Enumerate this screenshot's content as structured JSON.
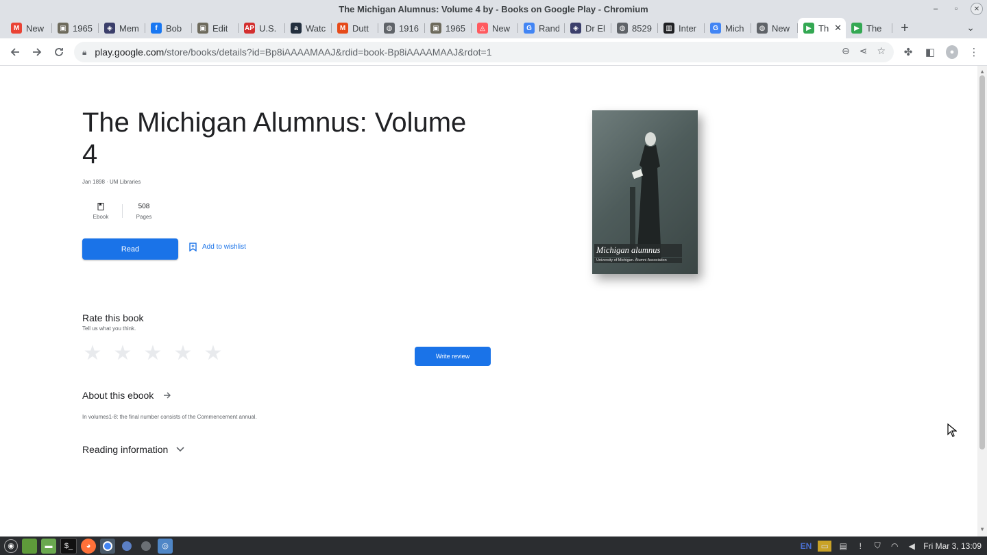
{
  "window": {
    "title": "The Michigan Alumnus: Volume 4 by - Books on Google Play - Chromium"
  },
  "tabs": [
    {
      "label": "New",
      "icon": "gmail-icon",
      "color": "#ea4335",
      "glyph": "M"
    },
    {
      "label": "1965",
      "icon": "photo-icon",
      "color": "#6d6a5c",
      "glyph": "▣"
    },
    {
      "label": "Mem",
      "icon": "memorial-icon",
      "color": "#3b3f6b",
      "glyph": "◈"
    },
    {
      "label": "Bob",
      "icon": "facebook-icon",
      "color": "#1877f2",
      "glyph": "f"
    },
    {
      "label": "Edit",
      "icon": "photo-icon",
      "color": "#6d6a5c",
      "glyph": "▣"
    },
    {
      "label": "U.S.",
      "icon": "ap-icon",
      "color": "#d32f2f",
      "glyph": "AP"
    },
    {
      "label": "Watc",
      "icon": "amazon-icon",
      "color": "#232f3e",
      "glyph": "a"
    },
    {
      "label": "Dutt",
      "icon": "newspaper-icon",
      "color": "#e64a19",
      "glyph": "M"
    },
    {
      "label": "1916",
      "icon": "globe-icon",
      "color": "#5f6368",
      "glyph": "◍"
    },
    {
      "label": "1965",
      "icon": "photo-icon",
      "color": "#6d6a5c",
      "glyph": "▣"
    },
    {
      "label": "New",
      "icon": "airbnb-icon",
      "color": "#ff5a5f",
      "glyph": "◬"
    },
    {
      "label": "Rand",
      "icon": "google-icon",
      "color": "#4285f4",
      "glyph": "G"
    },
    {
      "label": "Dr El",
      "icon": "memorial-icon",
      "color": "#3b3f6b",
      "glyph": "◈"
    },
    {
      "label": "8529",
      "icon": "globe-icon",
      "color": "#5f6368",
      "glyph": "◍"
    },
    {
      "label": "Inter",
      "icon": "archive-icon",
      "color": "#202124",
      "glyph": "▥"
    },
    {
      "label": "Mich",
      "icon": "google-icon",
      "color": "#4285f4",
      "glyph": "G"
    },
    {
      "label": "New",
      "icon": "globe-icon",
      "color": "#5f6368",
      "glyph": "◍"
    },
    {
      "label": "Th",
      "icon": "google-play-icon",
      "color": "#34a853",
      "glyph": "▶",
      "active": true
    },
    {
      "label": "The",
      "icon": "google-play-icon",
      "color": "#34a853",
      "glyph": "▶"
    }
  ],
  "omnibox": {
    "host": "play.google.com",
    "path": "/store/books/details?id=Bp8iAAAAMAAJ&rdid=book-Bp8iAAAAMAAJ&rdot=1"
  },
  "book": {
    "title": "The Michigan Alumnus: Volume 4",
    "meta": "Jan 1898 · UM Libraries",
    "format_label": "Ebook",
    "pages_value": "508",
    "pages_label": "Pages",
    "read_label": "Read",
    "wishlist_label": "Add to wishlist",
    "cover_title": "Michigan alumnus",
    "cover_subtitle": "University of Michigan. Alumni Association"
  },
  "rating": {
    "title": "Rate this book",
    "subtitle": "Tell us what you think.",
    "stars_total": 5,
    "write_review_label": "Write review"
  },
  "about": {
    "title": "About this ebook",
    "text": "In volumes1-8: the final number consists of the Commencement annual."
  },
  "reading_info": {
    "title": "Reading information"
  },
  "taskbar": {
    "lang": "EN",
    "clock": "Fri Mar 3, 13:09"
  },
  "colors": {
    "accent": "#1a73e8",
    "text": "#202124",
    "muted": "#5f6368"
  }
}
